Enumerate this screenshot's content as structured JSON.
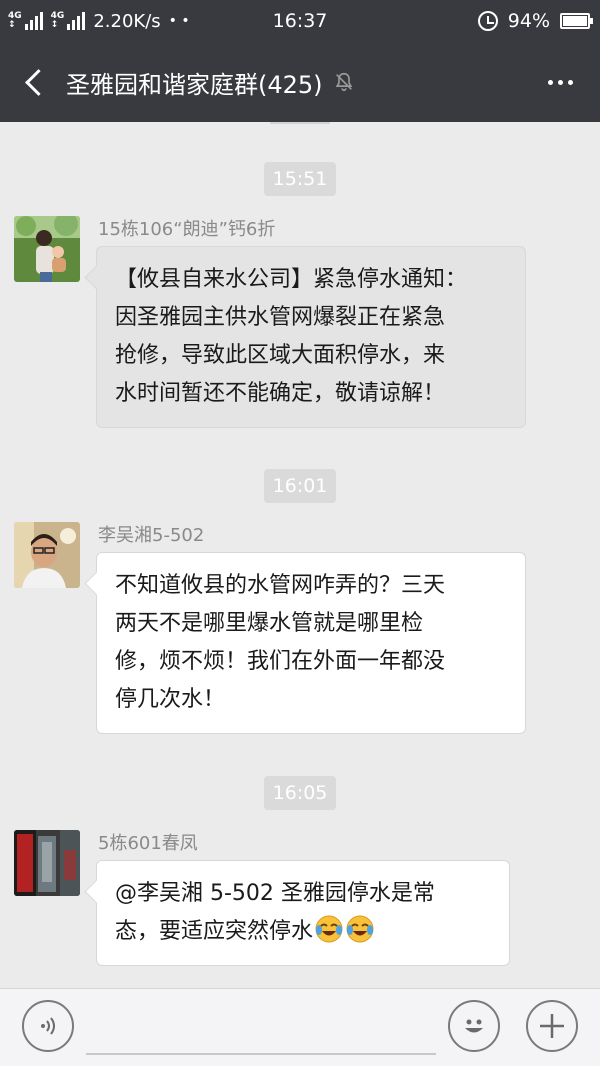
{
  "status_bar": {
    "network_tags": [
      "4G",
      "4G"
    ],
    "speed": "2.20K/s",
    "time": "16:37",
    "battery_percent": "94%",
    "battery_level": 0.94
  },
  "nav": {
    "title": "圣雅园和谐家庭群(425)",
    "back_icon": "chevron-left-icon",
    "mute_icon": "muted-bell-icon",
    "more_icon": "more-dots-icon"
  },
  "messages": [
    {
      "time": "15:51",
      "sender": "15栋106“朗迪”钙6折",
      "text": "【攸县自来水公司】紧急停水通知：\n因圣雅园主供水管网爆裂正在紧急\n抢修，导致此区域大面积停水，来\n水时间暂还不能确定，敬请谅解！"
    },
    {
      "time": "16:01",
      "sender": "李吴湘5-502",
      "text": "不知道攸县的水管网咋弄的？三天\n两天不是哪里爆水管就是哪里检\n修，烦不烦！我们在外面一年都没\n停几次水！"
    },
    {
      "time": "16:05",
      "sender": "5栋601春凤",
      "text": "@李吴湘 5-502  圣雅园停水是常\n态，要适应突然停水",
      "emoji": [
        "crying-laughing-emoji",
        "crying-laughing-emoji"
      ]
    }
  ],
  "input_bar": {
    "voice_icon": "voice-icon",
    "emoji_icon": "smiley-icon",
    "plus_icon": "plus-icon",
    "placeholder": ""
  },
  "colors": {
    "header_bg": "#393a3f",
    "chat_bg": "#ebebeb",
    "bubble_bg": "#ffffff",
    "time_badge_bg": "#dadada"
  }
}
